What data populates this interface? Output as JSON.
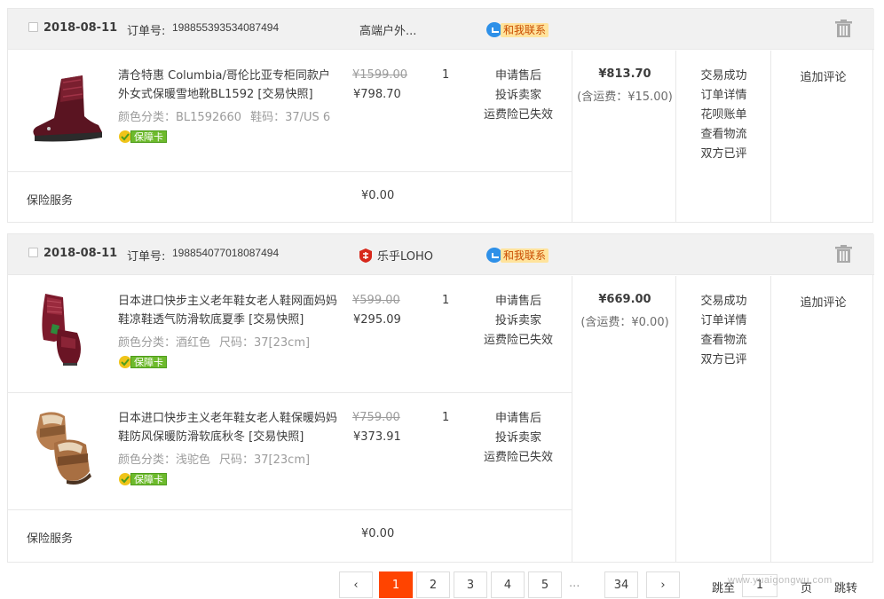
{
  "orders": [
    {
      "date": "2018-08-11",
      "order_label": "订单号:",
      "order_no": "198855393534087494",
      "shop_name": "高端户外...",
      "contact_label": "和我联系",
      "items": [
        {
          "title": "清仓特惠 Columbia/哥伦比亚专柜同款户外女式保暖雪地靴BL1592 [交易快照]",
          "sku_color": "颜色分类：BL1592660",
          "sku_size": "鞋码：37/US 6",
          "badge": "保障卡",
          "original_price": "¥1599.00",
          "price": "¥798.70",
          "qty": "1",
          "services": [
            "申请售后",
            "投诉卖家",
            "运费险已失效"
          ],
          "thumb_icon": "boot-icon"
        }
      ],
      "insurance": {
        "label": "保险服务",
        "price": "¥0.00"
      },
      "total": "¥813.70",
      "shipping": "(含运费：¥15.00)",
      "statuses": [
        "交易成功",
        "订单详情",
        "花呗账单",
        "查看物流",
        "双方已评"
      ],
      "review": "追加评论"
    },
    {
      "date": "2018-08-11",
      "order_label": "订单号:",
      "order_no": "198854077018087494",
      "shop_name": "乐乎LOHO",
      "contact_label": "和我联系",
      "items": [
        {
          "title": "日本进口快步主义老年鞋女老人鞋网面妈妈鞋凉鞋透气防滑软底夏季 [交易快照]",
          "sku_color": "颜色分类：酒红色",
          "sku_size": "尺码：37[23cm]",
          "badge": "保障卡",
          "original_price": "¥599.00",
          "price": "¥295.09",
          "qty": "1",
          "services": [
            "申请售后",
            "投诉卖家",
            "运费险已失效"
          ],
          "thumb_icon": "shoe-icon"
        },
        {
          "title": "日本进口快步主义老年鞋女老人鞋保暖妈妈鞋防风保暖防滑软底秋冬 [交易快照]",
          "sku_color": "颜色分类：浅驼色",
          "sku_size": "尺码：37[23cm]",
          "badge": "保障卡",
          "original_price": "¥759.00",
          "price": "¥373.91",
          "qty": "1",
          "services": [
            "申请售后",
            "投诉卖家",
            "运费险已失效"
          ],
          "thumb_icon": "shoe-icon"
        }
      ],
      "insurance": {
        "label": "保险服务",
        "price": "¥0.00"
      },
      "total": "¥669.00",
      "shipping": "(含运费：¥0.00)",
      "statuses": [
        "交易成功",
        "订单详情",
        "查看物流",
        "双方已评"
      ],
      "review": "追加评论"
    }
  ],
  "pagination": {
    "prev": "‹",
    "pages": [
      "1",
      "2",
      "3",
      "4",
      "5"
    ],
    "ellipsis": "...",
    "last": "34",
    "next": "›",
    "current": "1",
    "jump_label": "跳至",
    "jump_value": "1",
    "page_unit": "页",
    "go_label": "跳转"
  },
  "watermark": "www.yuaigongwu.com",
  "colors": {
    "accent": "#ff4400",
    "header_bg": "#f1f1f1",
    "border": "#e8e8e8",
    "contact_bg": "#ffe39c",
    "badge_green": "#6dba2c"
  }
}
